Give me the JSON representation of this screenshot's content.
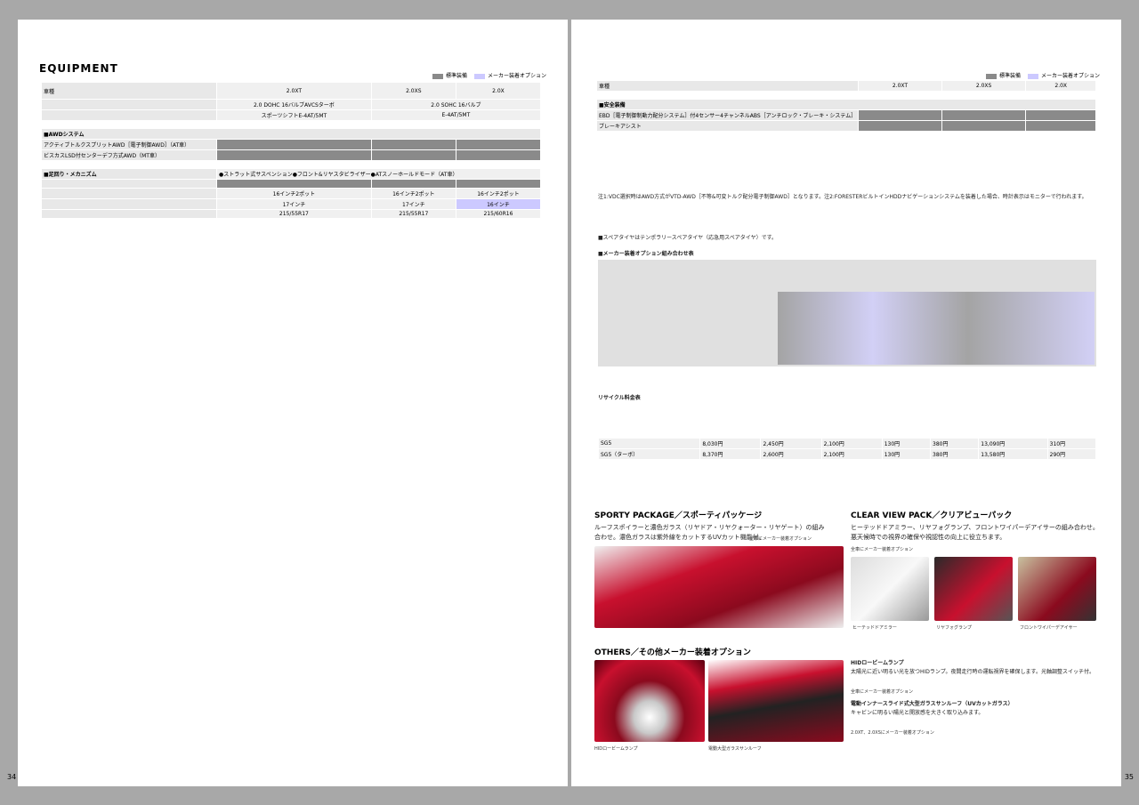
{
  "left": {
    "title": "EQUIPMENT",
    "page_number": "34",
    "legend": {
      "standard": "標準装備",
      "option": "メーカー装着オプション"
    },
    "header": {
      "vehicle_label": "車種",
      "grades": [
        "2.0XT",
        "2.0XS",
        "2.0X"
      ],
      "engines": [
        "2.0 DOHC 16バルブAVCSターボ",
        "2.0 SOHC 16バルブ"
      ],
      "trans": [
        "スポーツシフトE-4AT/5MT",
        "E-4AT/5MT"
      ]
    },
    "awd": {
      "title": "■AWDシステム",
      "r1": "アクティブトルクスプリットAWD［電子制御AWD］（AT車）",
      "r2": "ビスカスLSD付センターデフ方式AWD（MT車）"
    },
    "chassis": {
      "title": "■足回り・メカニズム",
      "note": "●ストラット式サスペンション●フロント&リヤスタビライザー●ATスノーホールドモード（AT車）",
      "brake": "16インチ2ポット",
      "wheel": "17インチ",
      "wheel_x": "16インチ",
      "tire_1": "215/55R17",
      "tire_2": "215/60R16"
    }
  },
  "right": {
    "page_number": "35",
    "legend": {
      "standard": "標準装備",
      "option": "メーカー装着オプション"
    },
    "header": {
      "vehicle_label": "車種",
      "grades": [
        "2.0XT",
        "2.0XS",
        "2.0X"
      ]
    },
    "safety": {
      "title": "■安全装備",
      "r1": "EBD［電子制御制動力配分システム］付4センサー4チャンネルABS［アンチロック・ブレーキ・システム］",
      "r2": "ブレーキアシスト"
    },
    "notes": "注1:VDC選択時はAWD方式がVTD-AWD［不等&可変トルク配分電子制御AWD］となります。注2:FORESTERビルトインHDDナビゲーションシステムを装着した場合、時計表示はモニターで行われます。",
    "spec_note": "■スペアタイヤはテンポラリースペアタイヤ（応急用スペアタイヤ）です。",
    "option_combo_title": "■メーカー装着オプション組み合わせ表",
    "recycle_title": "リサイクル料金表",
    "recycle_rows": [
      [
        "SG5",
        "8,030円",
        "2,450円",
        "2,100円",
        "130円",
        "380円",
        "13,090円",
        "310円"
      ],
      [
        "SG5（ターボ）",
        "8,370円",
        "2,600円",
        "2,100円",
        "130円",
        "380円",
        "13,580円",
        "290円"
      ]
    ],
    "sporty": {
      "title": "SPORTY PACKAGE／スポーティパッケージ",
      "desc": "ルーフスポイラーと濃色ガラス（リヤドア・リヤクォーター・リヤゲート）の組み合わせ。濃色ガラスは紫外線をカットするUVカット機能付。",
      "note": "全車にメーカー装着オプション"
    },
    "clear": {
      "title": "CLEAR VIEW PACK／クリアビューパック",
      "desc": "ヒーテッドドアミラー、リヤフォグランプ、フロントワイパーデアイサーの組み合わせ。悪天候時での視界の確保や視認性の向上に役立ちます。",
      "note": "全車にメーカー装着オプション",
      "caps": [
        "ヒーテッドドアミラー",
        "リヤフォグランプ",
        "フロントワイパーデアイサー"
      ]
    },
    "others": {
      "title": "OTHERS／その他メーカー装着オプション",
      "hid_title": "HIDロービームランプ",
      "hid_desc": "太陽光に近い明るい光を放つHIDランプ。夜間走行時の運転視界を確保します。光軸調整スイッチ付。",
      "hid_note": "全車にメーカー装着オプション",
      "roof_title": "電動インナースライド式大型ガラスサンルーフ（UVカットガラス）",
      "roof_desc": "キャビンに明るい陽光と開放感を大きく取り込みます。",
      "roof_note": "2.0XT、2.0XSにメーカー装着オプション",
      "caps": [
        "HIDロービームランプ",
        "電動大型ガラスサンルーフ"
      ]
    }
  }
}
